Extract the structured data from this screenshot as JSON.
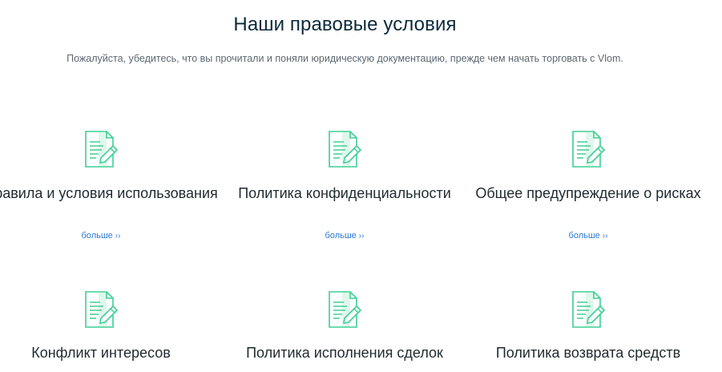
{
  "header": {
    "title": "Наши правовые условия",
    "subtitle": "Пожалуйста, убедитесь, что вы прочитали и поняли юридическую документацию, прежде чем начать торговать с Vlom."
  },
  "cards": [
    {
      "title": "Правила и условия использования",
      "more_label": "больше",
      "more_arrows": "››",
      "icon": "document-edit-icon"
    },
    {
      "title": "Политика конфиденциальности",
      "more_label": "больше",
      "more_arrows": "››",
      "icon": "document-edit-icon"
    },
    {
      "title": "Общее предупреждение о рисках",
      "more_label": "больше",
      "more_arrows": "››",
      "icon": "document-edit-icon"
    },
    {
      "title": "Конфликт интересов",
      "icon": "document-edit-icon"
    },
    {
      "title": "Политика исполнения сделок",
      "icon": "document-edit-icon"
    },
    {
      "title": "Политика возврата средств",
      "icon": "document-edit-icon"
    }
  ],
  "colors": {
    "icon_stroke": "#3dcf93",
    "icon_fill": "#dff7ec",
    "link": "#2b7bd8",
    "title": "#0b2a3a"
  }
}
